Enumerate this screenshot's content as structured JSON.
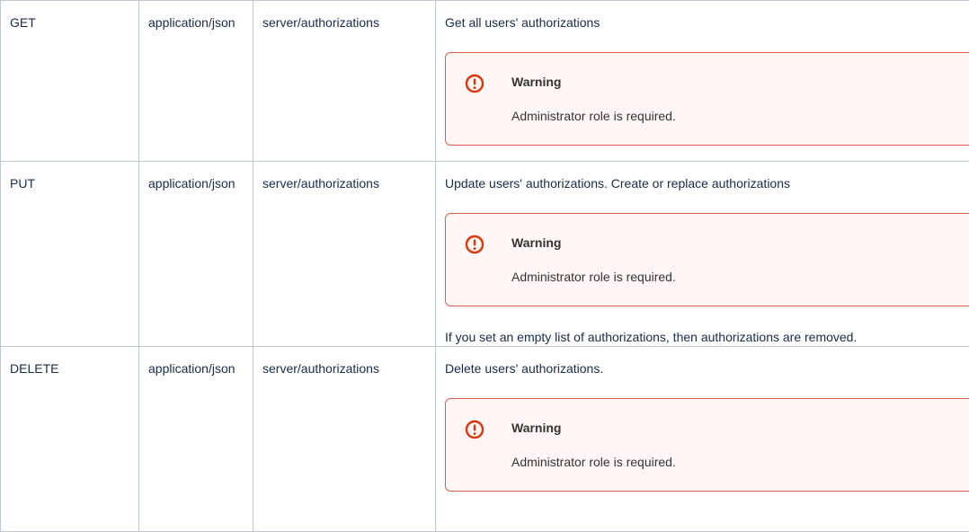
{
  "rows": [
    {
      "method": "GET",
      "content_type": "application/json",
      "path": "server/authorizations",
      "description": "Get all users' authorizations",
      "warning": {
        "title": "Warning",
        "body": "Administrator role is required."
      }
    },
    {
      "method": "PUT",
      "content_type": "application/json",
      "path": "server/authorizations",
      "description": "Update users' authorizations. Create or replace authorizations",
      "warning": {
        "title": "Warning",
        "body": "Administrator role is required."
      },
      "note": "If you set an empty list of authorizations, then authorizations are removed."
    },
    {
      "method": "DELETE",
      "content_type": "application/json",
      "path": "server/authorizations",
      "description": "Delete users' authorizations.",
      "warning": {
        "title": "Warning",
        "body": "Administrator role is required."
      }
    }
  ],
  "colors": {
    "warning_border": "#de5e4d",
    "warning_background": "#fff6f5",
    "table_border": "#c1c7d0"
  },
  "icons": {
    "warning": "exclamation-circle-icon"
  }
}
